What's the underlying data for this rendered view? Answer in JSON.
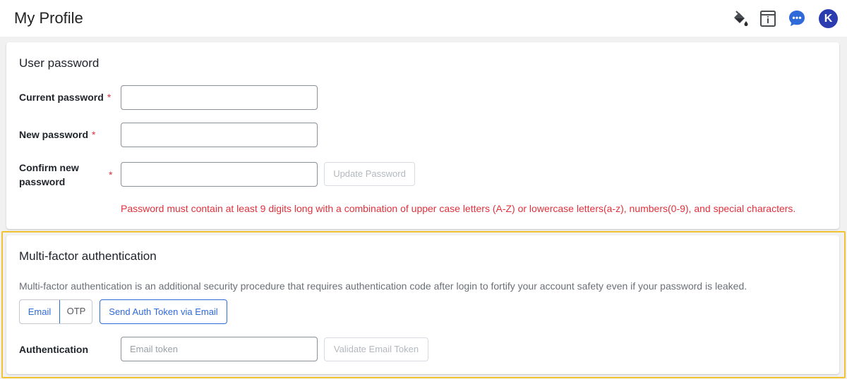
{
  "header": {
    "title": "My Profile",
    "icons": [
      "paint-bucket-icon",
      "info-panel-icon",
      "chat-bubble-icon"
    ],
    "avatar_initial": "K",
    "accent_color": "#2f6ad9"
  },
  "password_section": {
    "title": "User password",
    "current_label": "Current password",
    "new_label": "New password",
    "confirm_label": "Confirm new password",
    "required_marker": "*",
    "current_value": "",
    "new_value": "",
    "confirm_value": "",
    "update_button": "Update Password",
    "hint": "Password must contain at least 9 digits long with a combination of upper case letters (A-Z) or lowercase letters(a-z), numbers(0-9), and special characters."
  },
  "mfa_section": {
    "title": "Multi-factor authentication",
    "description": "Multi-factor authentication is an additional security procedure that requires authentication code after login to fortify your account safety even if your password is leaked.",
    "method_options": [
      "Email",
      "OTP"
    ],
    "selected_method": "Email",
    "send_button": "Send Auth Token via Email",
    "auth_label": "Authentication",
    "token_placeholder": "Email token",
    "token_value": "",
    "validate_button": "Validate Email Token"
  }
}
